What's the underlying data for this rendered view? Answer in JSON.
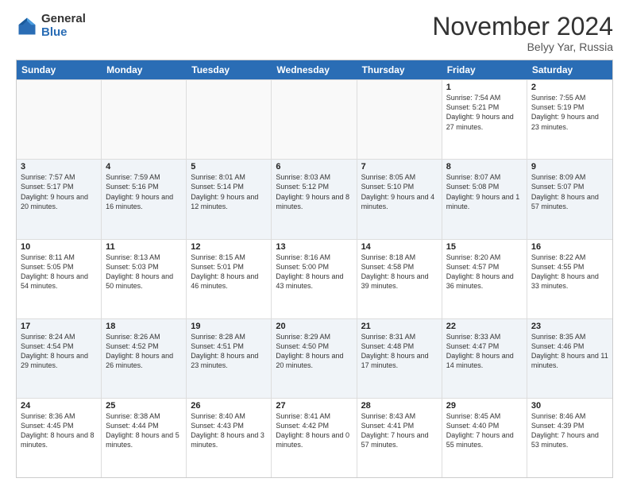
{
  "logo": {
    "general": "General",
    "blue": "Blue"
  },
  "title": "November 2024",
  "location": "Belyy Yar, Russia",
  "days_of_week": [
    "Sunday",
    "Monday",
    "Tuesday",
    "Wednesday",
    "Thursday",
    "Friday",
    "Saturday"
  ],
  "weeks": [
    [
      {
        "day": "",
        "info": ""
      },
      {
        "day": "",
        "info": ""
      },
      {
        "day": "",
        "info": ""
      },
      {
        "day": "",
        "info": ""
      },
      {
        "day": "",
        "info": ""
      },
      {
        "day": "1",
        "info": "Sunrise: 7:54 AM\nSunset: 5:21 PM\nDaylight: 9 hours and 27 minutes."
      },
      {
        "day": "2",
        "info": "Sunrise: 7:55 AM\nSunset: 5:19 PM\nDaylight: 9 hours and 23 minutes."
      }
    ],
    [
      {
        "day": "3",
        "info": "Sunrise: 7:57 AM\nSunset: 5:17 PM\nDaylight: 9 hours and 20 minutes."
      },
      {
        "day": "4",
        "info": "Sunrise: 7:59 AM\nSunset: 5:16 PM\nDaylight: 9 hours and 16 minutes."
      },
      {
        "day": "5",
        "info": "Sunrise: 8:01 AM\nSunset: 5:14 PM\nDaylight: 9 hours and 12 minutes."
      },
      {
        "day": "6",
        "info": "Sunrise: 8:03 AM\nSunset: 5:12 PM\nDaylight: 9 hours and 8 minutes."
      },
      {
        "day": "7",
        "info": "Sunrise: 8:05 AM\nSunset: 5:10 PM\nDaylight: 9 hours and 4 minutes."
      },
      {
        "day": "8",
        "info": "Sunrise: 8:07 AM\nSunset: 5:08 PM\nDaylight: 9 hours and 1 minute."
      },
      {
        "day": "9",
        "info": "Sunrise: 8:09 AM\nSunset: 5:07 PM\nDaylight: 8 hours and 57 minutes."
      }
    ],
    [
      {
        "day": "10",
        "info": "Sunrise: 8:11 AM\nSunset: 5:05 PM\nDaylight: 8 hours and 54 minutes."
      },
      {
        "day": "11",
        "info": "Sunrise: 8:13 AM\nSunset: 5:03 PM\nDaylight: 8 hours and 50 minutes."
      },
      {
        "day": "12",
        "info": "Sunrise: 8:15 AM\nSunset: 5:01 PM\nDaylight: 8 hours and 46 minutes."
      },
      {
        "day": "13",
        "info": "Sunrise: 8:16 AM\nSunset: 5:00 PM\nDaylight: 8 hours and 43 minutes."
      },
      {
        "day": "14",
        "info": "Sunrise: 8:18 AM\nSunset: 4:58 PM\nDaylight: 8 hours and 39 minutes."
      },
      {
        "day": "15",
        "info": "Sunrise: 8:20 AM\nSunset: 4:57 PM\nDaylight: 8 hours and 36 minutes."
      },
      {
        "day": "16",
        "info": "Sunrise: 8:22 AM\nSunset: 4:55 PM\nDaylight: 8 hours and 33 minutes."
      }
    ],
    [
      {
        "day": "17",
        "info": "Sunrise: 8:24 AM\nSunset: 4:54 PM\nDaylight: 8 hours and 29 minutes."
      },
      {
        "day": "18",
        "info": "Sunrise: 8:26 AM\nSunset: 4:52 PM\nDaylight: 8 hours and 26 minutes."
      },
      {
        "day": "19",
        "info": "Sunrise: 8:28 AM\nSunset: 4:51 PM\nDaylight: 8 hours and 23 minutes."
      },
      {
        "day": "20",
        "info": "Sunrise: 8:29 AM\nSunset: 4:50 PM\nDaylight: 8 hours and 20 minutes."
      },
      {
        "day": "21",
        "info": "Sunrise: 8:31 AM\nSunset: 4:48 PM\nDaylight: 8 hours and 17 minutes."
      },
      {
        "day": "22",
        "info": "Sunrise: 8:33 AM\nSunset: 4:47 PM\nDaylight: 8 hours and 14 minutes."
      },
      {
        "day": "23",
        "info": "Sunrise: 8:35 AM\nSunset: 4:46 PM\nDaylight: 8 hours and 11 minutes."
      }
    ],
    [
      {
        "day": "24",
        "info": "Sunrise: 8:36 AM\nSunset: 4:45 PM\nDaylight: 8 hours and 8 minutes."
      },
      {
        "day": "25",
        "info": "Sunrise: 8:38 AM\nSunset: 4:44 PM\nDaylight: 8 hours and 5 minutes."
      },
      {
        "day": "26",
        "info": "Sunrise: 8:40 AM\nSunset: 4:43 PM\nDaylight: 8 hours and 3 minutes."
      },
      {
        "day": "27",
        "info": "Sunrise: 8:41 AM\nSunset: 4:42 PM\nDaylight: 8 hours and 0 minutes."
      },
      {
        "day": "28",
        "info": "Sunrise: 8:43 AM\nSunset: 4:41 PM\nDaylight: 7 hours and 57 minutes."
      },
      {
        "day": "29",
        "info": "Sunrise: 8:45 AM\nSunset: 4:40 PM\nDaylight: 7 hours and 55 minutes."
      },
      {
        "day": "30",
        "info": "Sunrise: 8:46 AM\nSunset: 4:39 PM\nDaylight: 7 hours and 53 minutes."
      }
    ]
  ]
}
